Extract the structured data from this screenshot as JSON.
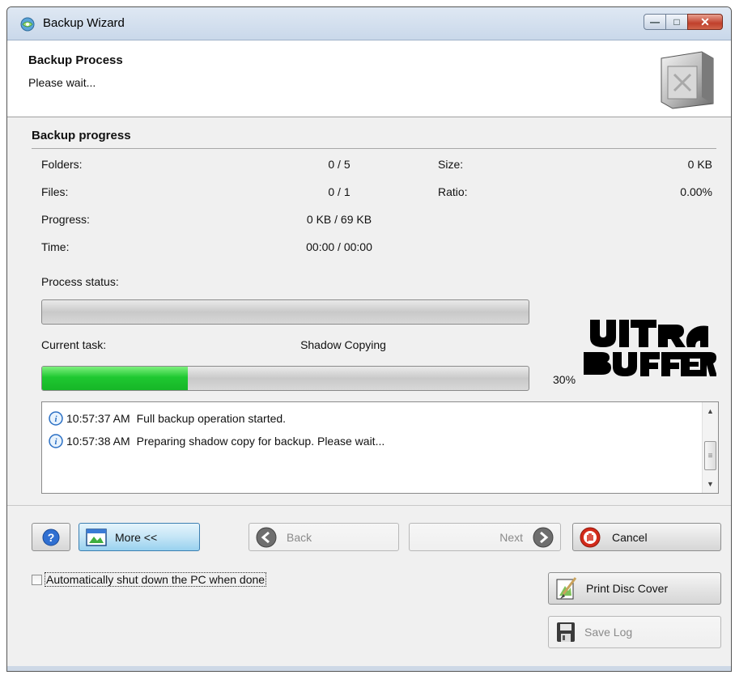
{
  "window": {
    "title": "Backup Wizard",
    "controls": {
      "minimize": "minimize-icon",
      "maximize": "maximize-icon",
      "close": "close-icon"
    }
  },
  "header": {
    "title": "Backup Process",
    "subtitle": "Please wait...",
    "icon": "safe-icon"
  },
  "progress": {
    "section_title": "Backup progress",
    "folders_label": "Folders:",
    "folders_value": "0 / 5",
    "size_label": "Size:",
    "size_value": "0 KB",
    "files_label": "Files:",
    "files_value": "0 / 1",
    "ratio_label": "Ratio:",
    "ratio_value": "0.00%",
    "progress_label": "Progress:",
    "progress_value": "0 KB / 69 KB",
    "time_label": "Time:",
    "time_value": "00:00 / 00:00",
    "process_status_label": "Process status:",
    "process_status_fraction": 0,
    "current_task_label": "Current task:",
    "current_task_value": "Shadow Copying",
    "task_fraction": 0.3,
    "task_percent": "30%"
  },
  "log": {
    "entries": [
      {
        "time": "10:57:37 AM",
        "message": "Full backup operation started.",
        "icon": "info-icon"
      },
      {
        "time": "10:57:38 AM",
        "message": "Preparing shadow copy for backup. Please wait...",
        "icon": "info-icon"
      }
    ]
  },
  "buttons": {
    "more": "More <<",
    "back": "Back",
    "next": "Next",
    "cancel": "Cancel",
    "print_disc_cover": "Print Disc Cover",
    "save_log": "Save Log"
  },
  "options": {
    "auto_shutdown_label": "Automatically shut down the PC when done",
    "auto_shutdown_checked": false
  },
  "colors": {
    "progress_green": "#1fc831",
    "active_button": "#98d1ef",
    "cancel_red": "#d32a1a"
  }
}
